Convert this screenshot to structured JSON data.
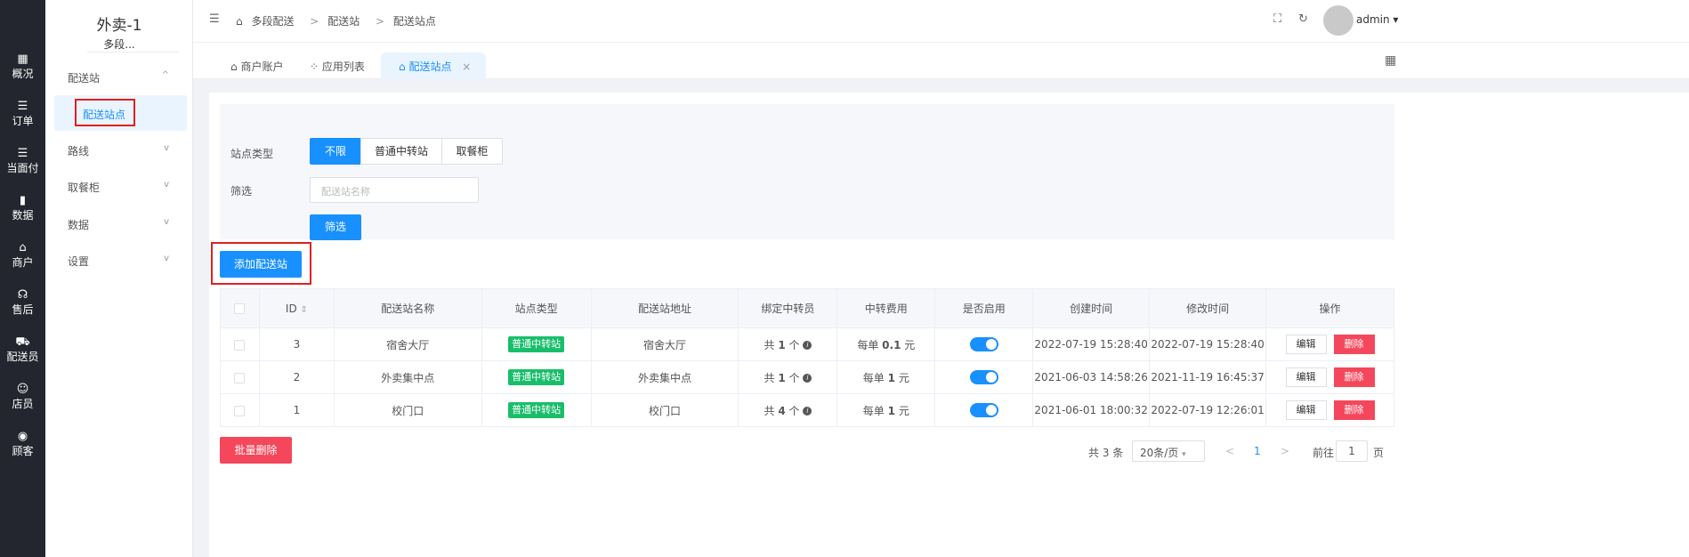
{
  "rail": {
    "items": [
      {
        "icon": "▦",
        "label": "概况"
      },
      {
        "icon": "☰",
        "label": "订单"
      },
      {
        "icon": "☰",
        "label": "当面付"
      },
      {
        "icon": "▮",
        "label": "数据"
      },
      {
        "icon": "⌂",
        "label": "商户"
      },
      {
        "icon": "☊",
        "label": "售后"
      },
      {
        "icon": "⛟",
        "label": "配送员"
      },
      {
        "icon": "☺",
        "label": "店员"
      },
      {
        "icon": "◉",
        "label": "顾客"
      }
    ]
  },
  "sidebar": {
    "store_title": "外卖-1",
    "store_sub": "多段...",
    "menu": [
      {
        "label": "配送站",
        "chev": "^"
      },
      {
        "label": "路线",
        "chev": "v"
      },
      {
        "label": "取餐柜",
        "chev": "v"
      },
      {
        "label": "数据",
        "chev": "v"
      },
      {
        "label": "设置",
        "chev": "v"
      }
    ],
    "active_sub": "配送站点"
  },
  "header": {
    "breadcrumb": [
      "多段配送",
      "配送站",
      "配送站点"
    ],
    "bc_sep": ">",
    "user": "admin"
  },
  "tabs": {
    "items": [
      "商户账户",
      "应用列表"
    ],
    "active": "配送站点",
    "close": "×"
  },
  "filter": {
    "type_label": "站点类型",
    "type_options": [
      "不限",
      "普通中转站",
      "取餐柜"
    ],
    "selected": "不限",
    "filter_label": "筛选",
    "name_placeholder": "配送站名称",
    "submit": "筛选"
  },
  "actions": {
    "add": "添加配送站",
    "batch_delete": "批量删除"
  },
  "table": {
    "headers": [
      "ID",
      "配送站名称",
      "站点类型",
      "配送站地址",
      "绑定中转员",
      "中转费用",
      "是否启用",
      "创建时间",
      "修改时间",
      "操作"
    ],
    "rows": [
      {
        "id": "3",
        "name": "宿舍大厅",
        "type": "普通中转站",
        "address": "宿舍大厅",
        "bind_pre": "共",
        "bind_num": "1",
        "bind_post": "个",
        "fee_pre": "每单",
        "fee_num": "0.1",
        "fee_post": "元",
        "enabled": true,
        "created": "2022-07-19 15:28:40",
        "modified": "2022-07-19 15:28:40"
      },
      {
        "id": "2",
        "name": "外卖集中点",
        "type": "普通中转站",
        "address": "外卖集中点",
        "bind_pre": "共",
        "bind_num": "1",
        "bind_post": "个",
        "fee_pre": "每单",
        "fee_num": "1",
        "fee_post": "元",
        "enabled": true,
        "created": "2021-06-03 14:58:26",
        "modified": "2021-11-19 16:45:37"
      },
      {
        "id": "1",
        "name": "校门口",
        "type": "普通中转站",
        "address": "校门口",
        "bind_pre": "共",
        "bind_num": "4",
        "bind_post": "个",
        "fee_pre": "每单",
        "fee_num": "1",
        "fee_post": "元",
        "enabled": true,
        "created": "2021-06-01 18:00:32",
        "modified": "2022-07-19 12:26:01"
      }
    ],
    "edit": "编辑",
    "delete": "删除"
  },
  "pagination": {
    "total": "共 3 条",
    "page_size": "20条/页",
    "prev": "<",
    "current": "1",
    "next": ">",
    "goto_label": "前往",
    "goto_value": "1",
    "goto_suffix": "页"
  }
}
